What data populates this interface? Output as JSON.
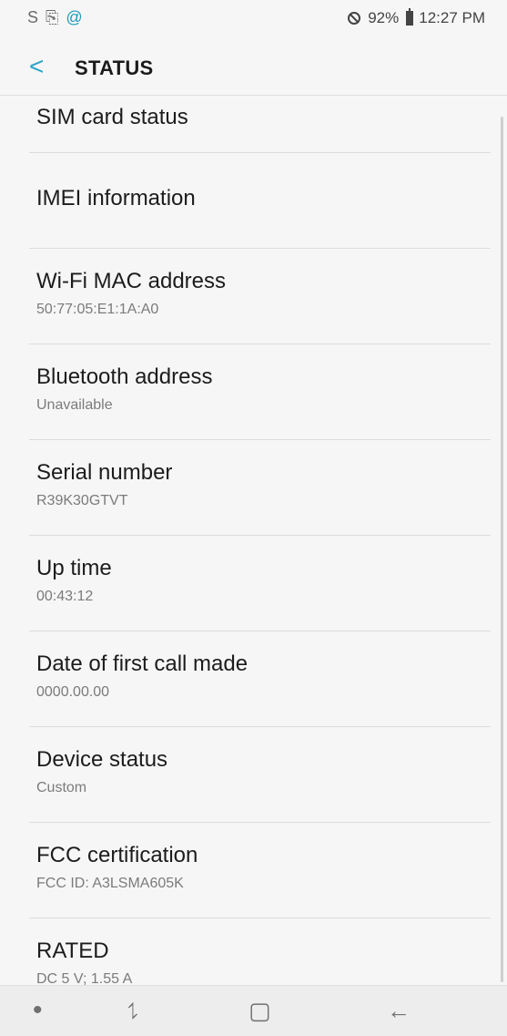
{
  "status_bar": {
    "left_icons": [
      "S",
      "⎘",
      "@"
    ],
    "battery": "92%",
    "time": "12:27 PM"
  },
  "header": {
    "back": "<",
    "title": "STATUS"
  },
  "items": [
    {
      "label": "SIM card status",
      "value": ""
    },
    {
      "label": "IMEI information",
      "value": ""
    },
    {
      "label": "Wi-Fi MAC address",
      "value": "50:77:05:E1:1A:A0"
    },
    {
      "label": "Bluetooth address",
      "value": "Unavailable"
    },
    {
      "label": "Serial number",
      "value": "R39K30GTVT"
    },
    {
      "label": "Up time",
      "value": "00:43:12"
    },
    {
      "label": "Date of first call made",
      "value": "0000.00.00"
    },
    {
      "label": "Device status",
      "value": "Custom"
    },
    {
      "label": "FCC certification",
      "value": "FCC ID: A3LSMA605K"
    },
    {
      "label": "RATED",
      "value": "DC 5 V; 1.55 A"
    }
  ],
  "nav_bar": {
    "dot": "•",
    "recent": "⥍",
    "home": "▢",
    "back": "←"
  },
  "colors": {
    "accent": "#2aa3c7",
    "background": "#f6f6f6",
    "divider": "#dcdcdc",
    "secondary_text": "#7b7b7b"
  },
  "icons": {
    "status_left": [
      "samsung-icon",
      "sim-icon",
      "notification-at-icon"
    ],
    "status_right": [
      "blocked-icon",
      "battery-icon"
    ],
    "nav": [
      "dot-icon",
      "recents-icon",
      "home-icon",
      "back-icon"
    ]
  }
}
